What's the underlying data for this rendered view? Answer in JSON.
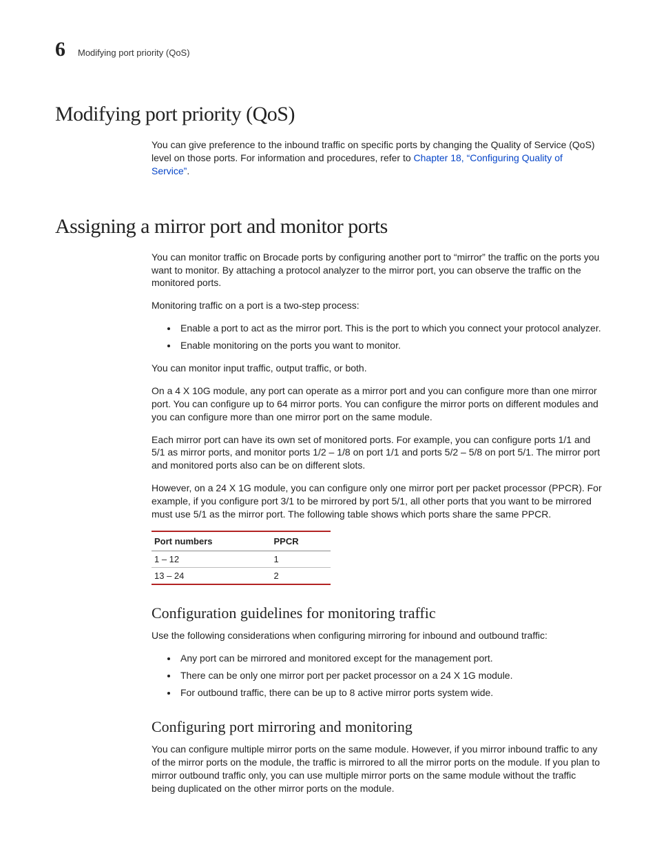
{
  "header": {
    "chapter_number": "6",
    "running_title": "Modifying port priority (QoS)"
  },
  "section1": {
    "title": "Modifying port priority (QoS)",
    "p1_pre": "You can give preference to the inbound traffic on specific ports by changing the Quality of Service (QoS) level on those ports.  For information and procedures, refer to ",
    "p1_link": "Chapter 18, “Configuring Quality of Service”",
    "p1_post": "."
  },
  "section2": {
    "title": "Assigning a mirror port and monitor ports",
    "p1": "You can monitor traffic on Brocade ports by configuring another port to “mirror” the traffic on the ports you want to monitor.  By attaching a protocol analyzer to the mirror port, you can observe the traffic on the monitored ports.",
    "p2": "Monitoring traffic on a port is a two-step process:",
    "bullets1": [
      "Enable a port to act as the mirror port.  This is the port to which you connect your protocol analyzer.",
      "Enable monitoring on the ports you want to monitor."
    ],
    "p3": "You can monitor input traffic, output traffic, or both.",
    "p4": "On a 4 X 10G module, any port can operate as a mirror port and you can configure more than one mirror port.  You can configure up to 64 mirror ports.  You can configure the mirror ports on different modules and you can configure more than one mirror port on the same module.",
    "p5": "Each mirror port can have its own set of monitored ports.  For example, you can configure ports 1/1 and 5/1 as mirror ports, and monitor ports 1/2 – 1/8 on port 1/1 and ports 5/2 – 5/8 on port 5/1.  The mirror port and monitored ports also can be on different slots.",
    "p6": "However, on a 24 X 1G module, you can configure only one mirror port per packet processor (PPCR). For example, if you configure port 3/1 to be mirrored by port 5/1, all other ports that you want to be mirrored must use 5/1 as the mirror port. The following table shows which ports share the same PPCR.",
    "table": {
      "col1": "Port numbers",
      "col2": "PPCR",
      "rows": [
        {
          "ports": "1 – 12",
          "ppcr": "1"
        },
        {
          "ports": "13 – 24",
          "ppcr": "2"
        }
      ]
    },
    "sub1": {
      "title": "Configuration guidelines for monitoring traffic",
      "intro": "Use the following considerations when configuring mirroring for inbound and outbound traffic:",
      "bullets": [
        "Any port can be mirrored and monitored except for the management port.",
        "There can be only one mirror port per packet processor on a 24 X 1G module.",
        "For outbound traffic, there can be up to 8 active mirror ports system wide."
      ]
    },
    "sub2": {
      "title": "Configuring port mirroring and monitoring",
      "p1": "You can configure multiple mirror ports on the same module. However, if you mirror inbound traffic to any of the mirror ports on the module, the traffic is mirrored to all the mirror ports on the module. If you plan to mirror outbound traffic only, you can use multiple mirror ports on the same module without the traffic being duplicated on the other mirror ports on the module."
    }
  }
}
